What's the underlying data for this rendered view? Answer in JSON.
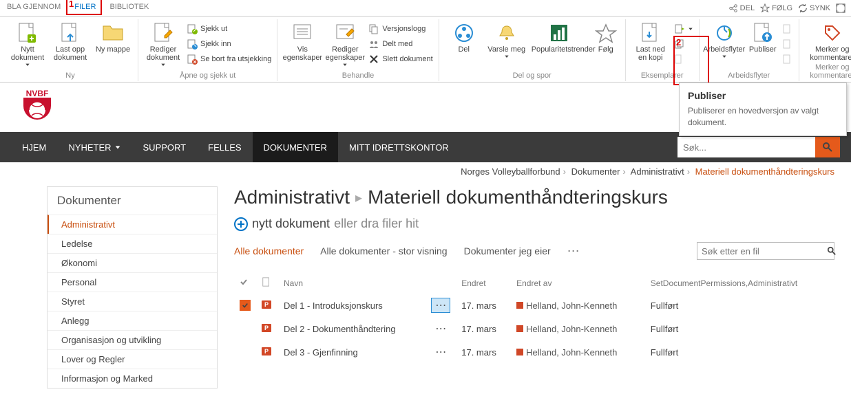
{
  "top_tabs": {
    "browse": "BLA GJENNOM",
    "files": "FILER",
    "library": "BIBLIOTEK"
  },
  "top_right": {
    "share": "DEL",
    "follow": "FØLG",
    "sync": "SYNK"
  },
  "ribbon": {
    "groups": {
      "ny": {
        "label": "Ny",
        "new_doc": "Nytt dokument",
        "upload": "Last opp dokument",
        "new_folder": "Ny mappe"
      },
      "apne": {
        "label": "Åpne og sjekk ut",
        "edit": "Rediger dokument",
        "checkout": "Sjekk ut",
        "checkin": "Sjekk inn",
        "discard": "Se bort fra utsjekking"
      },
      "behandle": {
        "label": "Behandle",
        "view_props": "Vis egenskaper",
        "edit_props": "Rediger egenskaper",
        "version": "Versjonslogg",
        "shared": "Delt med",
        "delete": "Slett dokument"
      },
      "delspor": {
        "label": "Del og spor",
        "del": "Del",
        "alert": "Varsle meg",
        "pop": "Popularitetstrender",
        "follow": "Følg"
      },
      "eksemplar": {
        "label": "Eksemplarer",
        "download": "Last ned en kopi"
      },
      "arb": {
        "label": "Arbeidsflyter",
        "wf": "Arbeidsflyter",
        "publish": "Publiser"
      },
      "merker": {
        "label": "Merker og kommentarer",
        "tags": "Merker og kommentarer"
      }
    }
  },
  "tooltip": {
    "title": "Publiser",
    "body": "Publiserer en hovedversjon av valgt dokument."
  },
  "logo_text": "NVBF",
  "nav": {
    "hjem": "HJEM",
    "nyheter": "NYHETER",
    "support": "SUPPORT",
    "felles": "FELLES",
    "dokumenter": "DOKUMENTER",
    "mitt": "MITT IDRETTSKONTOR",
    "search_placeholder": "Søk..."
  },
  "breadcrumb": {
    "a": "Norges Volleyballforbund",
    "b": "Dokumenter",
    "c": "Administrativt",
    "d": "Materiell dokumenthåndteringskurs"
  },
  "sidebar": {
    "title": "Dokumenter",
    "items": [
      "Administrativt",
      "Ledelse",
      "Økonomi",
      "Personal",
      "Styret",
      "Anlegg",
      "Organisasjon og utvikling",
      "Lover og Regler",
      "Informasjon og Marked"
    ]
  },
  "page_title": {
    "a": "Administrativt",
    "b": "Materiell dokumenthåndteringskurs"
  },
  "new_doc": {
    "a": "nytt dokument",
    "b": "eller dra filer hit"
  },
  "views": {
    "a": "Alle dokumenter",
    "b": "Alle dokumenter - stor visning",
    "c": "Dokumenter jeg eier"
  },
  "file_search_placeholder": "Søk etter en fil",
  "table": {
    "headers": {
      "name": "Navn",
      "modified": "Endret",
      "modified_by": "Endret av",
      "setperm": "SetDocumentPermissions,Administrativt"
    },
    "rows": [
      {
        "name": "Del 1 - Introduksjonskurs",
        "modified": "17. mars",
        "by": "Helland, John-Kenneth",
        "status": "Fullført",
        "checked": true,
        "highlight": true
      },
      {
        "name": "Del 2 - Dokumenthåndtering",
        "modified": "17. mars",
        "by": "Helland, John-Kenneth",
        "status": "Fullført",
        "checked": false,
        "highlight": false
      },
      {
        "name": "Del 3 - Gjenfinning",
        "modified": "17. mars",
        "by": "Helland, John-Kenneth",
        "status": "Fullført",
        "checked": false,
        "highlight": false
      }
    ]
  }
}
